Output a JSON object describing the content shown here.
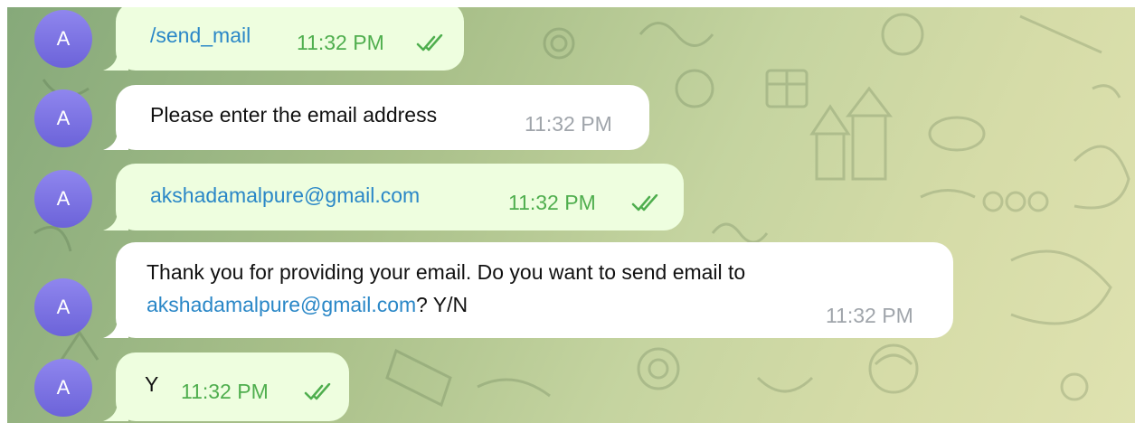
{
  "messages": [
    {
      "sender_initial": "A",
      "text": "/send_mail",
      "time": "11:32 PM",
      "direction": "outgoing",
      "status_icon": "double-check-icon"
    },
    {
      "sender_initial": "A",
      "text": "Please enter the email address",
      "time": "11:32 PM",
      "direction": "incoming"
    },
    {
      "sender_initial": "A",
      "text": "akshadamalpure@gmail.com",
      "time": "11:32 PM",
      "direction": "outgoing",
      "status_icon": "double-check-icon"
    },
    {
      "sender_initial": "A",
      "text_line1": "Thank you for providing your email. Do you want to send email to",
      "email_link": "akshadamalpure@gmail.com",
      "text_suffix": "? Y/N",
      "time": "11:32 PM",
      "direction": "incoming"
    },
    {
      "sender_initial": "A",
      "text": "Y",
      "time": "11:32 PM",
      "direction": "outgoing",
      "status_icon": "double-check-icon"
    }
  ],
  "colors": {
    "outgoing_bubble": "#eefedf",
    "incoming_bubble": "#ffffff",
    "link": "#2a87c7",
    "outgoing_time": "#4fae4e",
    "incoming_time": "#a0a5ab",
    "avatar": "#7b72e4"
  }
}
